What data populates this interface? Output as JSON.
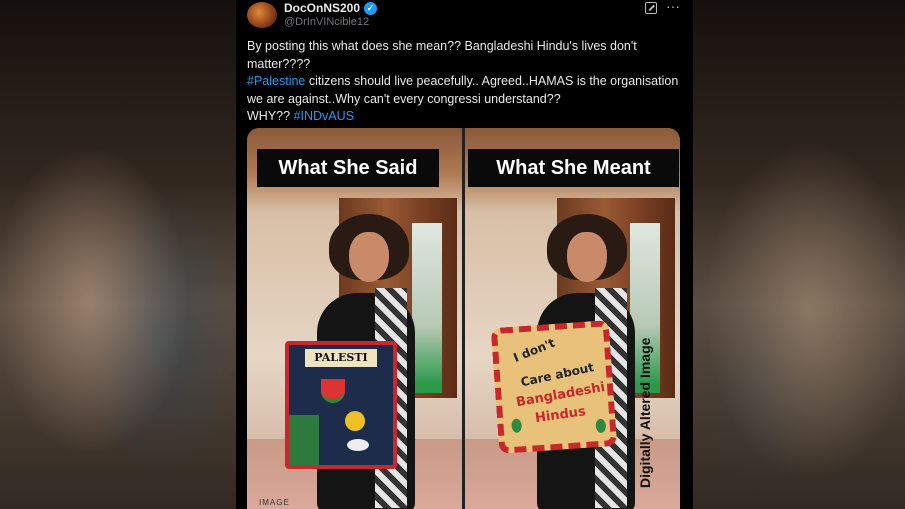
{
  "tweet": {
    "display_name": "DocOnNS200",
    "handle": "@DrInVINcible12",
    "verified_mark": "✓",
    "more_glyph": "···",
    "lines": [
      "By posting this what does she mean?? Bangladeshi Hindu's lives don't matter????",
      "citizens should live peacefully.. Agreed..HAMAS is the organisation we are against..Why can't every congressi understand??",
      "WHY??"
    ],
    "hashtags": [
      "#Palestine",
      "#INDvAUS"
    ]
  },
  "media": {
    "left_caption": "What She Said",
    "right_caption": "What She  Meant",
    "left_bag_label": "PALESTI",
    "right_bag_lines": [
      "I don't",
      "Care about",
      "Bangladeshi",
      "Hindus"
    ],
    "watermark": "Digitally Altered Image",
    "image_tag": "IMAGE"
  },
  "colors": {
    "accent": "#1d9bf0",
    "background": "#000000"
  }
}
